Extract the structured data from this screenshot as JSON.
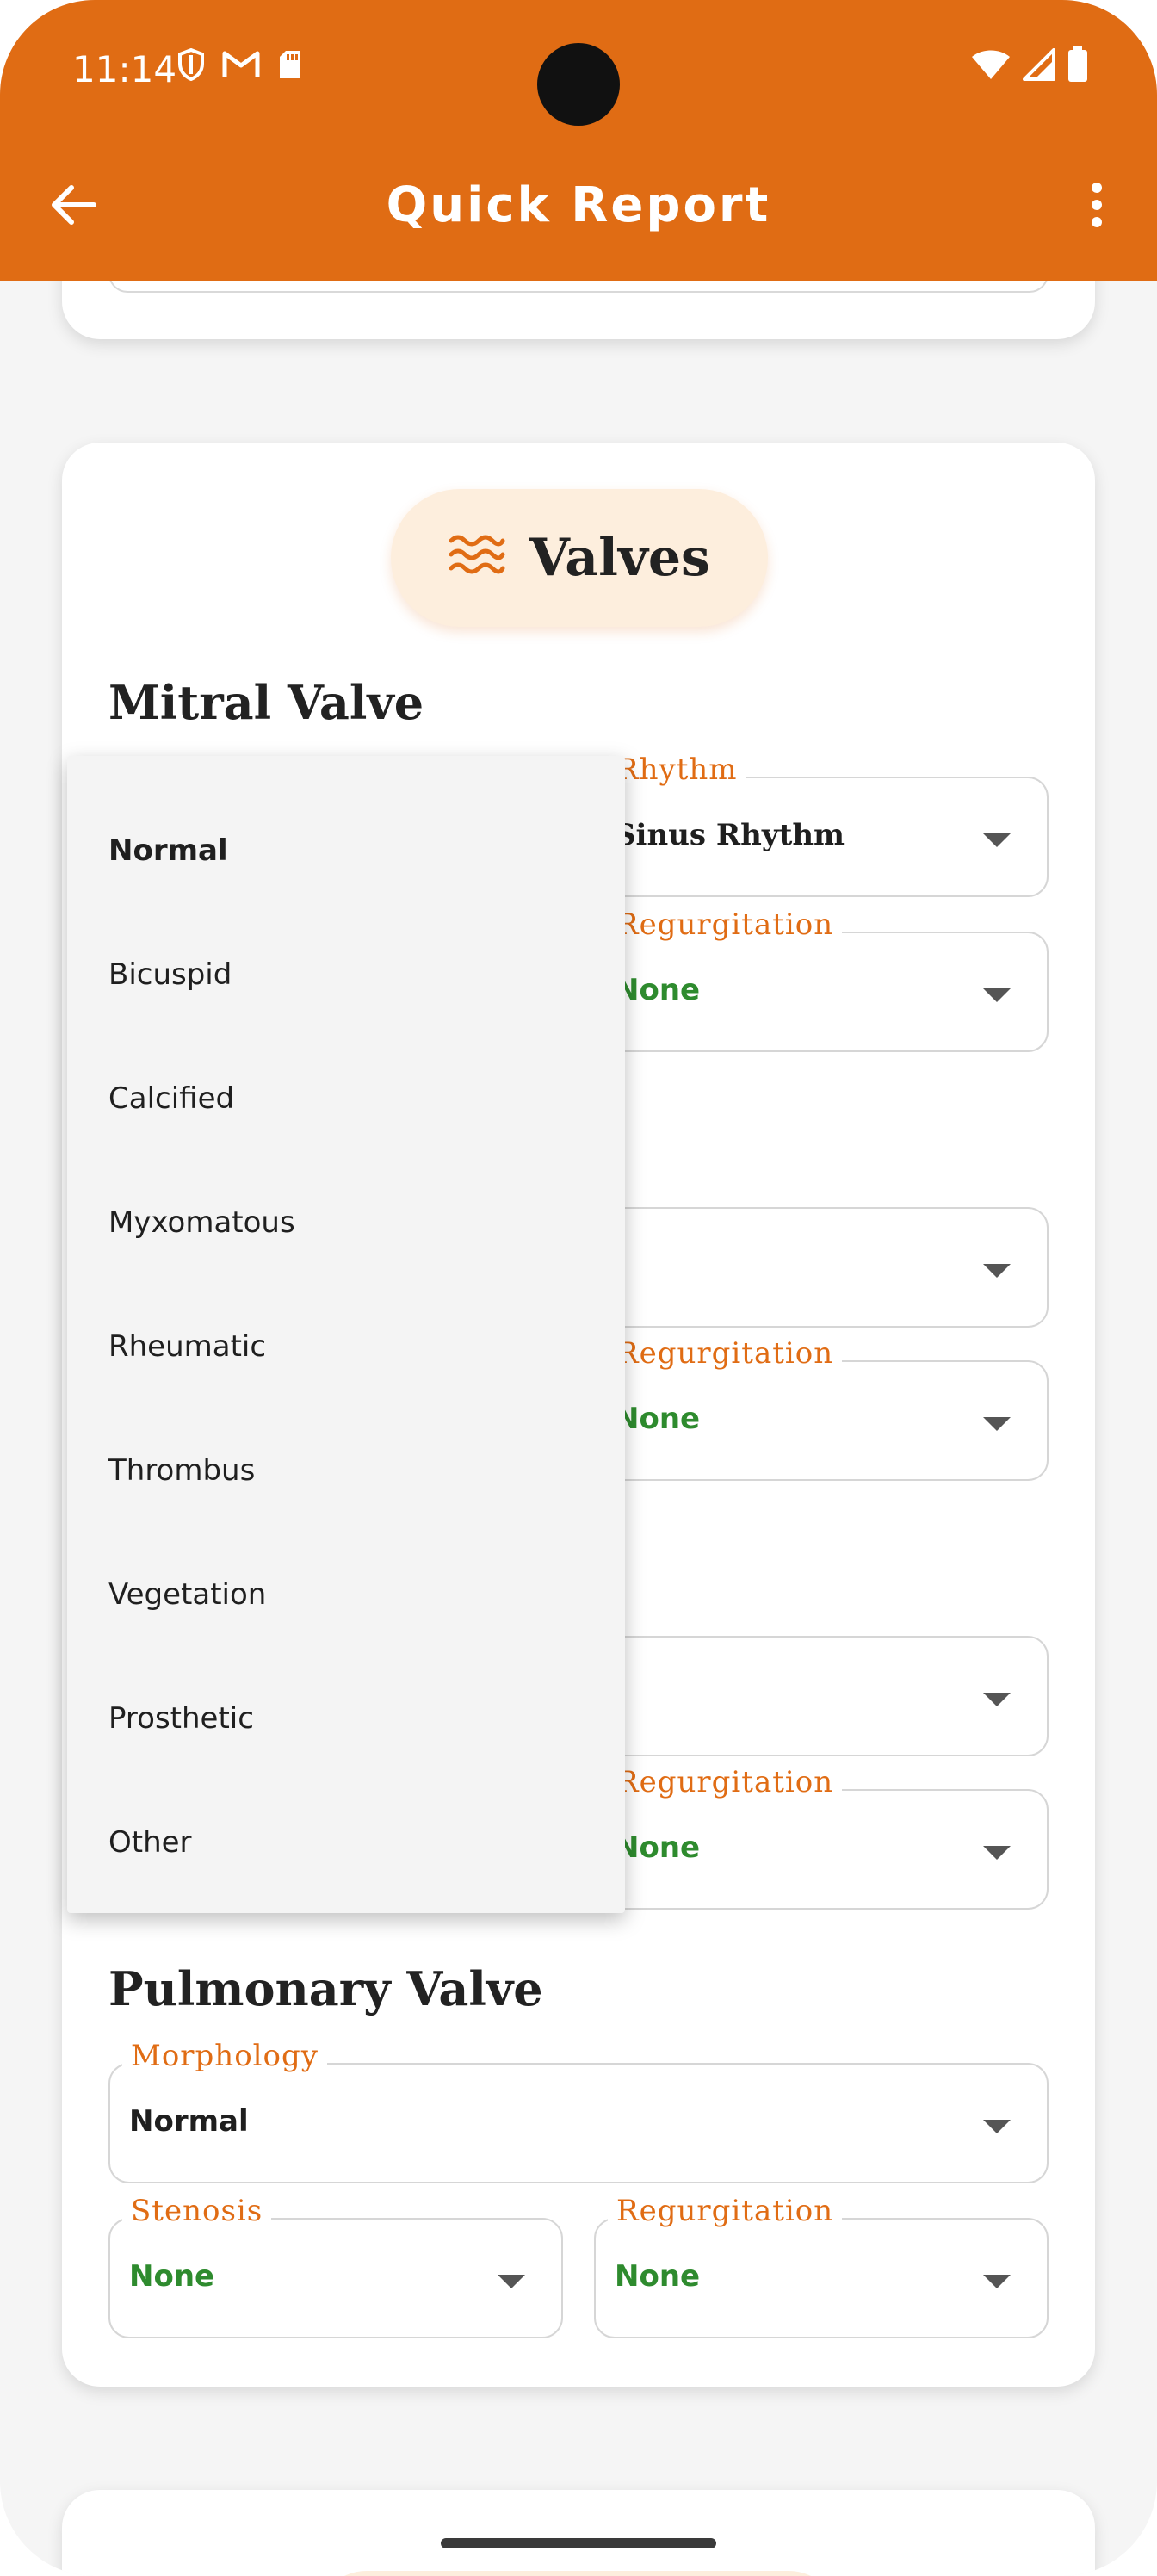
{
  "status_bar": {
    "time": "11:14",
    "icons_left": [
      "shield-icon",
      "gmail-icon",
      "sd-card-icon"
    ],
    "icons_right": [
      "wifi-icon",
      "cell-signal-icon",
      "battery-icon"
    ]
  },
  "app_bar": {
    "title": "Quick Report",
    "back_icon": "arrow-back-icon",
    "menu_icon": "more-vert-icon",
    "color": "#e06c14"
  },
  "section": {
    "title": "Valves",
    "icon": "waves-icon"
  },
  "mitral": {
    "heading": "Mitral Valve",
    "rhythm": {
      "label": "Rhythm",
      "value": "Sinus Rhythm"
    },
    "regurgitation": {
      "label": "Regurgitation",
      "value": "None"
    }
  },
  "valve2": {
    "morphology_value": "",
    "regurgitation": {
      "label": "Regurgitation",
      "value": "None"
    }
  },
  "valve3": {
    "morphology_value": "",
    "regurgitation": {
      "label": "Regurgitation",
      "value": "None"
    }
  },
  "pulmonary": {
    "heading": "Pulmonary Valve",
    "morphology": {
      "label": "Morphology",
      "value": "Normal"
    },
    "stenosis": {
      "label": "Stenosis",
      "value": "None"
    },
    "regurgitation": {
      "label": "Regurgitation",
      "value": "None"
    }
  },
  "dropdown": {
    "selected": "Normal",
    "options": [
      "Normal",
      "Bicuspid",
      "Calcified",
      "Myxomatous",
      "Rheumatic",
      "Thrombus",
      "Vegetation",
      "Prosthetic",
      "Other"
    ]
  },
  "colors": {
    "accent": "#e06c14",
    "chip_bg": "#fdeedd",
    "value_green": "#2e8b2e"
  }
}
